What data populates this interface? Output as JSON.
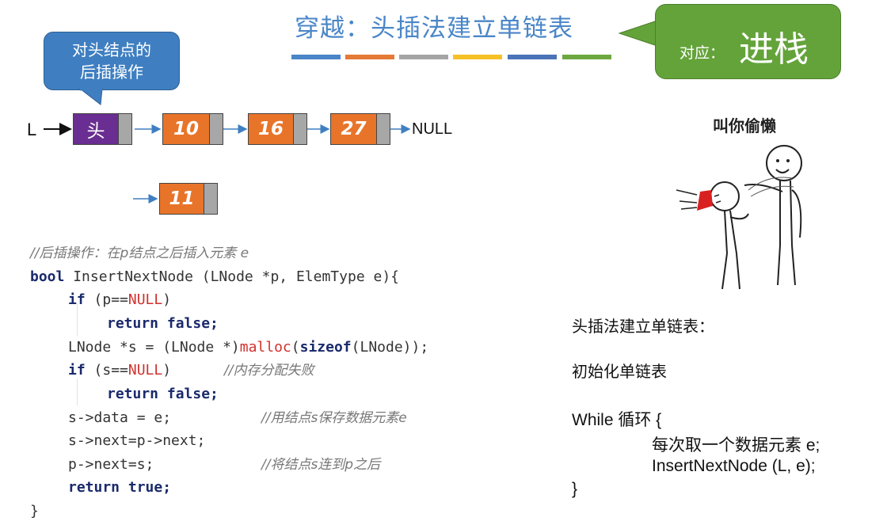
{
  "title": "穿越：头插法建立单链表",
  "callout_left": {
    "line1": "对头结点的",
    "line2": "后插操作"
  },
  "callout_right": {
    "small": "对应：",
    "big": "进栈"
  },
  "colors": {
    "title": "#4a86c8",
    "bars": [
      "#4a86c8",
      "#e47a35",
      "#a5a5a5",
      "#f6c127",
      "#4a73b8",
      "#6ca83f"
    ],
    "head_node": "#6a2d91",
    "data_node": "#e8742a",
    "pointer": "#a7a7a7"
  },
  "list": {
    "head_label": "L",
    "head_node": "头",
    "nodes": [
      "10",
      "16",
      "27"
    ],
    "null_label": "NULL",
    "new_node": "11"
  },
  "code": {
    "comment_header": "//后插操作：在p结点之后插入元素 e",
    "sig_bool": "bool",
    "sig_rest": " InsertNextNode (LNode *p, ElemType e){",
    "if1_kw": "if",
    "if1_a": " (p==",
    "if1_null": "NULL",
    "if1_b": ")",
    "ret_false_1": "return false;",
    "alloc_a": "LNode *s = (LNode *)",
    "alloc_malloc": "malloc",
    "alloc_b": "(",
    "alloc_sizeof": "sizeof",
    "alloc_c": "(LNode));",
    "if2_kw": "if",
    "if2_a": " (s==",
    "if2_null": "NULL",
    "if2_b": ")",
    "if2_comment": "//内存分配失败",
    "ret_false_2": "return false;",
    "assign_data": "s->data = e;",
    "assign_data_comment": "//用结点s保存数据元素e",
    "assign_next": "s->next=p->next;",
    "link": "p->next=s;",
    "link_comment": "//将结点s连到p之后",
    "ret_true": "return true;",
    "close": "}"
  },
  "right_text": {
    "heading": "头插法建立单链表：",
    "init": "初始化单链表",
    "while": "While 循环 {",
    "body1": "每次取一个数据元素 e;",
    "body2": "InsertNextNode (L, e);",
    "close": "}"
  },
  "meme": {
    "caption": "叫你偷懒"
  }
}
